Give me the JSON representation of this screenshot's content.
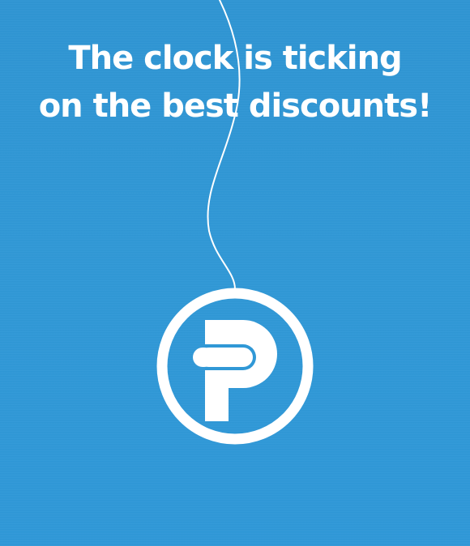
{
  "banner": {
    "headline_line1": "The clock is ticking",
    "headline_line2": "on the best discounts!",
    "logo_icon": "p-logo-icon",
    "string_icon": "hanging-string-icon"
  },
  "colors": {
    "background": "#3098d6",
    "foreground": "#ffffff"
  }
}
